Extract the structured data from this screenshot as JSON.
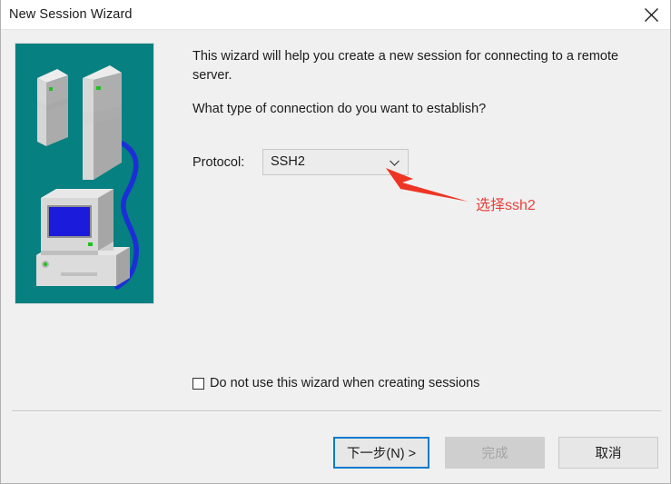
{
  "window": {
    "title": "New Session Wizard",
    "close_icon": "close-icon"
  },
  "illustration": {
    "name": "network-servers-and-computer-illustration",
    "background_color": "#068080",
    "cable_color": "#1c2fd6",
    "device_color": "#cfcfcf",
    "screen_color": "#1b1bdc",
    "led_color": "#20c020"
  },
  "content": {
    "intro_text": "This wizard will help you create a new session for connecting to a remote server.",
    "question_text": "What type of connection do you want to establish?",
    "protocol_label": "Protocol:",
    "protocol_value": "SSH2",
    "protocol_options": [
      "SSH2"
    ],
    "chevron_icon": "chevron-down-icon"
  },
  "annotation": {
    "text": "选择ssh2",
    "color": "#e8413c",
    "arrow_icon": "arrow-pointer-icon"
  },
  "checkbox": {
    "label": "Do not use this wizard when creating sessions",
    "checked": false
  },
  "footer": {
    "next_label": "下一步(N) >",
    "finish_label": "完成",
    "cancel_label": "取消",
    "focus_color": "#0a7bce"
  }
}
